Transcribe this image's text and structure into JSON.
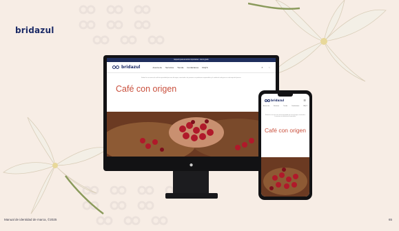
{
  "brand": {
    "logo_text": "bridazul"
  },
  "footer": {
    "text": "Manual de identidad de marca, ©2025",
    "page_number": "65"
  },
  "website": {
    "announcement": "Espacio para anuncios importantes · Envío gratis",
    "logo_text": "bridazul",
    "nav_links": [
      "Acerca de",
      "Servicios",
      "Tienda",
      "Contáctanos",
      "FAQ'S"
    ],
    "nav_icons": [
      "search-icon",
      "chat-icon"
    ],
    "intro": "Bridazul es una marca de café de especialidad que nace del origen, conectando a las personas con productores responsables y el cuidado de cada grano en cada etapa del proceso.",
    "hero_title": "Café con origen"
  },
  "mobile": {
    "logo_text": "bridazul",
    "nav_links": [
      "Acerca de",
      "Servicios",
      "Tienda",
      "Contáctanos",
      "FAQ'S"
    ],
    "intro": "Bridazul es una marca de café de especialidad que nace del origen, conectando a las personas con productores responsables.",
    "hero_title": "Café con origen"
  },
  "colors": {
    "background": "#f7ede5",
    "brand_blue": "#1b2a66",
    "accent_red": "#c94f3c"
  }
}
